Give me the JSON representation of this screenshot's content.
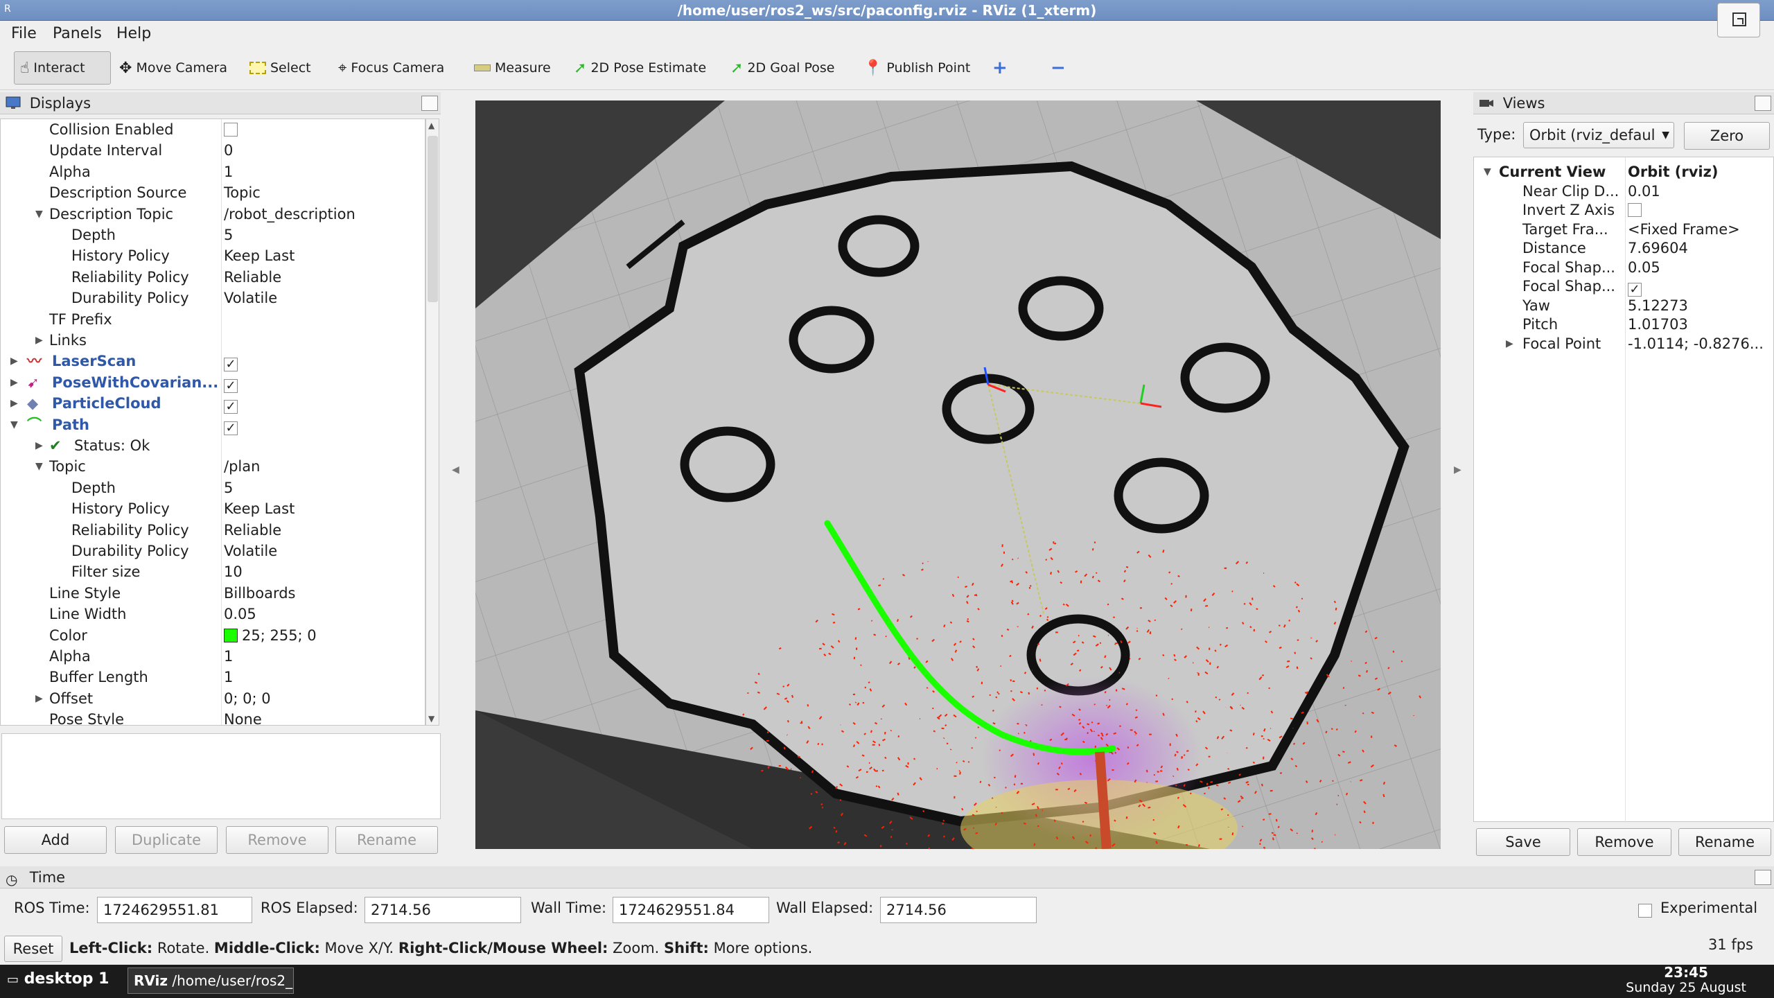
{
  "window": {
    "title": "/home/user/ros2_ws/src/paconfig.rviz - RViz (1_xterm)"
  },
  "menu": [
    "File",
    "Panels",
    "Help"
  ],
  "toolbar": {
    "interact": "Interact",
    "move_camera": "Move Camera",
    "select": "Select",
    "focus_camera": "Focus Camera",
    "measure": "Measure",
    "pose_estimate": "2D Pose Estimate",
    "goal_pose": "2D Goal Pose",
    "publish_point": "Publish Point"
  },
  "displays": {
    "title": "Displays",
    "rows": [
      {
        "label": "Collision Enabled",
        "value": "",
        "checkbox": false
      },
      {
        "label": "Update Interval",
        "value": "0"
      },
      {
        "label": "Alpha",
        "value": "1"
      },
      {
        "label": "Description Source",
        "value": "Topic"
      },
      {
        "label": "Description Topic",
        "value": "/robot_description"
      },
      {
        "label": "Depth",
        "value": "5"
      },
      {
        "label": "History Policy",
        "value": "Keep Last"
      },
      {
        "label": "Reliability Policy",
        "value": "Reliable"
      },
      {
        "label": "Durability Policy",
        "value": "Volatile"
      },
      {
        "label": "TF Prefix",
        "value": ""
      },
      {
        "label": "Links",
        "value": ""
      },
      {
        "label": "LaserScan",
        "value": ""
      },
      {
        "label": "PoseWithCovarian...",
        "value": ""
      },
      {
        "label": "ParticleCloud",
        "value": ""
      },
      {
        "label": "Path",
        "value": ""
      },
      {
        "label": "Status: Ok",
        "value": ""
      },
      {
        "label": "Topic",
        "value": "/plan"
      },
      {
        "label": "Depth",
        "value": "5"
      },
      {
        "label": "History Policy",
        "value": "Keep Last"
      },
      {
        "label": "Reliability Policy",
        "value": "Reliable"
      },
      {
        "label": "Durability Policy",
        "value": "Volatile"
      },
      {
        "label": "Filter size",
        "value": "10"
      },
      {
        "label": "Line Style",
        "value": "Billboards"
      },
      {
        "label": "Line Width",
        "value": "0.05"
      },
      {
        "label": "Color",
        "value": "25; 255; 0"
      },
      {
        "label": "Alpha",
        "value": "1"
      },
      {
        "label": "Buffer Length",
        "value": "1"
      },
      {
        "label": "Offset",
        "value": "0; 0; 0"
      },
      {
        "label": "Pose Style",
        "value": "None"
      }
    ],
    "buttons": {
      "add": "Add",
      "duplicate": "Duplicate",
      "remove": "Remove",
      "rename": "Rename"
    }
  },
  "views": {
    "title": "Views",
    "type_label": "Type:",
    "type_value": "Orbit (rviz_defaul",
    "zero": "Zero",
    "rows": [
      {
        "key": "Current View",
        "value": "Orbit (rviz)"
      },
      {
        "key": "Near Clip D...",
        "value": "0.01"
      },
      {
        "key": "Invert Z Axis",
        "value": ""
      },
      {
        "key": "Target Fra...",
        "value": "<Fixed Frame>"
      },
      {
        "key": "Distance",
        "value": "7.69604"
      },
      {
        "key": "Focal Shap...",
        "value": "0.05"
      },
      {
        "key": "Focal Shap...",
        "value": ""
      },
      {
        "key": "Yaw",
        "value": "5.12273"
      },
      {
        "key": "Pitch",
        "value": "1.01703"
      },
      {
        "key": "Focal Point",
        "value": "-1.0114; -0.8276..."
      }
    ],
    "buttons": {
      "save": "Save",
      "remove": "Remove",
      "rename": "Rename"
    }
  },
  "time": {
    "title": "Time",
    "ros_time_label": "ROS Time:",
    "ros_time": "1724629551.81",
    "ros_elapsed_label": "ROS Elapsed:",
    "ros_elapsed": "2714.56",
    "wall_time_label": "Wall Time:",
    "wall_time": "1724629551.84",
    "wall_elapsed_label": "Wall Elapsed:",
    "wall_elapsed": "2714.56",
    "experimental": "Experimental"
  },
  "status": {
    "reset": "Reset",
    "k1": "Left-Click:",
    "t1": " Rotate. ",
    "k2": "Middle-Click:",
    "t2": " Move X/Y. ",
    "k3": "Right-Click/Mouse Wheel:",
    "t3": " Zoom. ",
    "k4": "Shift:",
    "t4": " More options.",
    "fps": "31 fps"
  },
  "taskbar": {
    "desktop": "desktop 1",
    "task": "/home/user/ros2_...",
    "task_icon": "RViz",
    "time": "23:45",
    "date": "Sunday 25 August"
  },
  "colors": {
    "path": "#19ff00",
    "laser": "#ff2000",
    "title_bar": "#6e8fc1"
  }
}
